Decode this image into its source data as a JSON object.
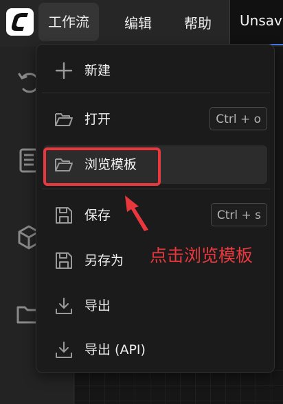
{
  "menubar": {
    "logo_icon": "comfy-logo-icon",
    "items": [
      {
        "label": "工作流"
      },
      {
        "label": "编辑"
      },
      {
        "label": "帮助"
      }
    ],
    "file_tab": "Unsaved"
  },
  "sidebar": {
    "icons": [
      "history-icon",
      "document-icon",
      "cube-icon",
      "folder-icon"
    ]
  },
  "dropdown": {
    "items": [
      {
        "label": "新建",
        "icon": "plus-icon",
        "shortcut": ""
      },
      {
        "label": "打开",
        "icon": "folder-open-icon",
        "shortcut": "Ctrl + o"
      },
      {
        "label": "浏览模板",
        "icon": "folder-open-icon",
        "shortcut": ""
      },
      {
        "label": "保存",
        "icon": "save-icon",
        "shortcut": "Ctrl + s"
      },
      {
        "label": "另存为",
        "icon": "save-icon",
        "shortcut": ""
      },
      {
        "label": "导出",
        "icon": "download-icon",
        "shortcut": ""
      },
      {
        "label": "导出 (API)",
        "icon": "download-icon",
        "shortcut": ""
      }
    ]
  },
  "annotation": {
    "text": "点击浏览模板",
    "color": "#e8383d"
  },
  "colors": {
    "menubar_bg": "#262626",
    "dropdown_bg": "#1b1b1c",
    "hover_bg": "#2c2c2d",
    "tab_accent": "#4a7ae8"
  }
}
